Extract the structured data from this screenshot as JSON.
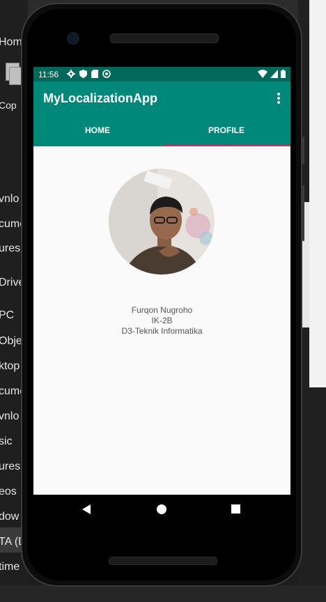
{
  "desktop": {
    "top_tab": "Hom",
    "copy_label": "Cop",
    "sidebar_items": [
      "vnlo",
      "cume",
      "ures",
      "Drive",
      "PC",
      "Obje",
      "ktop",
      "cume",
      "vnlo",
      "sic",
      "ures",
      "eos",
      "dow",
      "TA (D",
      "time"
    ]
  },
  "status_bar": {
    "time": "11:56"
  },
  "app": {
    "title": "MyLocalizationApp",
    "overflow_icon": "more-vert-icon"
  },
  "tabs": [
    {
      "label": "HOME",
      "selected": false
    },
    {
      "label": "PROFILE",
      "selected": true
    }
  ],
  "profile": {
    "name": "Furqon Nugroho",
    "class": "IK-2B",
    "program": "D3-Teknik Informatika"
  },
  "colors": {
    "status_bar": "#00695c",
    "app_bar": "#00897b",
    "tab_indicator": "#e91e63"
  }
}
